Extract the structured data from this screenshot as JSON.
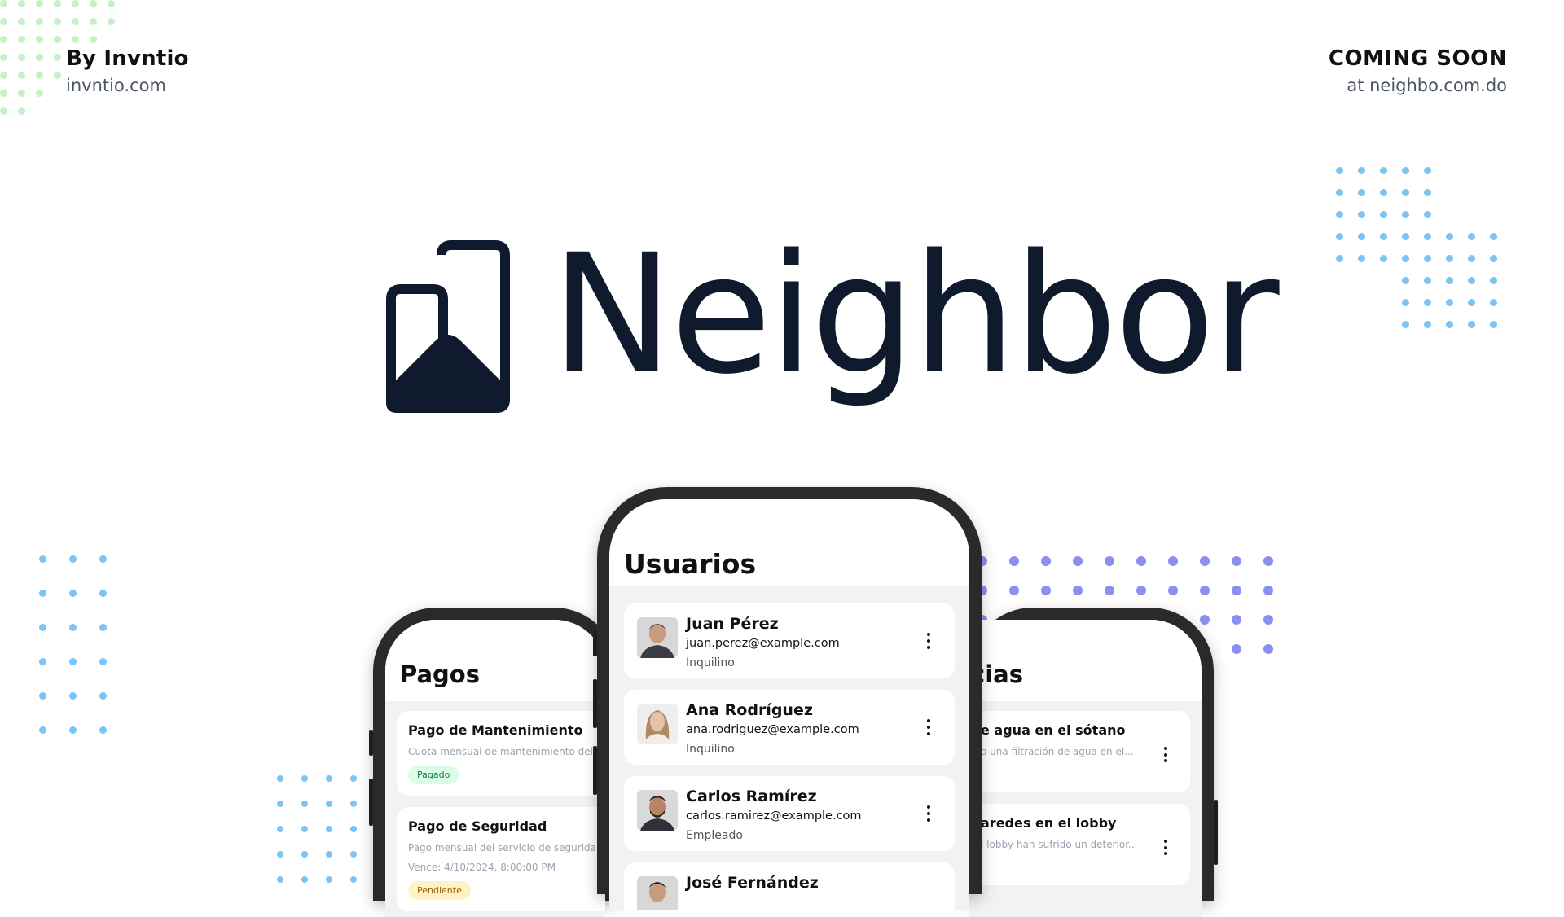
{
  "branding": {
    "by_title": "By Invntio",
    "by_url": "invntio.com",
    "coming_title": "COMING SOON",
    "coming_url": "at neighbo.com.do",
    "logo_word": "Neighbor"
  },
  "colors": {
    "logo": "#0f1b2d",
    "dots_light_blue": "#7cc4f5",
    "dots_purple": "#8b8ff0",
    "dots_green": "#c7f0c7"
  },
  "left_phone": {
    "title": "Pagos",
    "payments": [
      {
        "title": "Pago de Mantenimiento",
        "description": "Cuota mensual de mantenimiento del",
        "due": "",
        "status": "Pagado",
        "status_color": "green"
      },
      {
        "title": "Pago de Seguridad",
        "description": "Pago mensual del servicio de segurida",
        "due": "Vence: 4/10/2024, 8:00:00 PM",
        "status": "Pendiente",
        "status_color": "yellow"
      }
    ]
  },
  "center_phone": {
    "title": "Usuarios",
    "users": [
      {
        "name": "Juan Pérez",
        "email": "juan.perez@example.com",
        "role": "Inquilino",
        "avatar_icon": "avatar-man-icon"
      },
      {
        "name": "Ana Rodríguez",
        "email": "ana.rodriguez@example.com",
        "role": "Inquilino",
        "avatar_icon": "avatar-woman-icon"
      },
      {
        "name": "Carlos Ramírez",
        "email": "carlos.ramirez@example.com",
        "role": "Empleado",
        "avatar_icon": "avatar-man-beard-icon"
      },
      {
        "name": "José Fernández",
        "email": "",
        "role": "",
        "avatar_icon": "avatar-man-icon"
      }
    ]
  },
  "right_phone": {
    "title": "cias",
    "incidents": [
      {
        "title": "e agua en el sótano",
        "description": "o una filtración de agua en el..."
      },
      {
        "title": "aredes en el lobby",
        "description": "l lobby han sufrido un deterior..."
      }
    ]
  }
}
